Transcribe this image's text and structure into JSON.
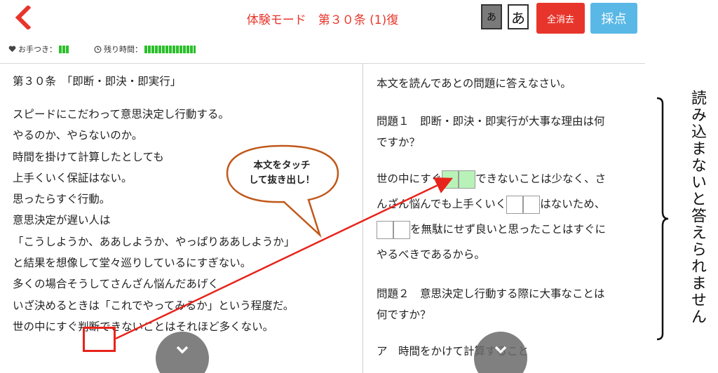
{
  "header": {
    "mode_title": "体験モード　第３０条 (1)復",
    "kana_small": "あ",
    "kana_large": "あ",
    "clear_all_label": "全消去",
    "score_label": "採点",
    "hint_label": "お手つき：",
    "time_label": "残り時間：",
    "hint_remaining_fraction": 0.15,
    "time_remaining_fraction": 1.0
  },
  "article": {
    "title": "第３０条　「即断・即決・即実行」",
    "lines": [
      "スピードにこだわって意思決定し行動する。",
      "やるのか、やらないのか。",
      "時間を掛けて計算したとしても",
      "上手くいく保証はない。",
      "思ったらすぐ行動。",
      "意思決定が遅い人は",
      "「こうしようか、ああしようか、やっぱりああしようか」",
      "と結果を想像して堂々巡りしているにすぎない。",
      "多くの場合そうしてさんざん悩んだあげく",
      "いざ決めるときは「これでやってみるか」という程度だ。",
      "世の中にすぐ判断できないことはそれほど多くない。"
    ]
  },
  "questions": {
    "instruction": "本文を読んであとの問題に答えなさい。",
    "q1_line1": "問題１　即断・即決・即実行が大事な理由は何",
    "q1_line2": "ですか？",
    "a1_part1": "世の中にすぐ",
    "a1_part2": "できないことは少なく、さ",
    "a1_part3": "んざん悩んでも上手くいく",
    "a1_part4": "はないため、",
    "a1_part5": "を無駄にせず良いと思ったことはすぐに",
    "a1_part6": "やるべきであるから。",
    "q2_line1": "問題２　意思決定し行動する際に大事なことは",
    "q2_line2": "何ですか？",
    "option_a": "ア　時間をかけて計算すること"
  },
  "callout": {
    "line1": "本文をタッチ",
    "line2": "して抜き出し！"
  },
  "side_note": "読み込まないと答えられません",
  "colors": {
    "accent_red": "#e8352b",
    "score_blue": "#5ab8e6",
    "bar_green": "#2bbf2b",
    "filled_box": "#b8f2b8",
    "callout_border": "#c0581a"
  },
  "icons": {
    "back": "chevron-left-icon",
    "hint": "heart-icon",
    "time": "clock-icon",
    "scroll": "chevron-down-icon"
  }
}
